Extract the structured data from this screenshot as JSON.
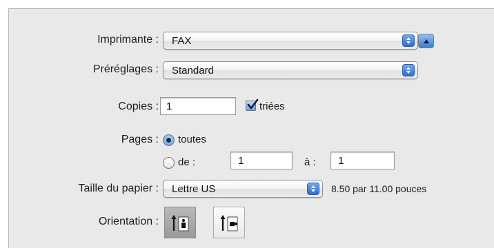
{
  "printer": {
    "label": "Imprimante :",
    "value": "FAX"
  },
  "presets": {
    "label": "Préréglages :",
    "value": "Standard"
  },
  "copies": {
    "label": "Copies :",
    "value": "1",
    "collate_label": "triées",
    "collate_checked": true
  },
  "pages": {
    "label": "Pages :",
    "all_label": "toutes",
    "from_label": "de :",
    "from_value": "1",
    "to_label": "à :",
    "to_value": "1",
    "selected": "all"
  },
  "paper_size": {
    "label": "Taille du papier :",
    "value": "Lettre US",
    "dimensions": "8.50 par 11.00 pouces"
  },
  "orientation": {
    "label": "Orientation :",
    "options": [
      "portrait",
      "landscape"
    ],
    "selected": "portrait"
  },
  "colors": {
    "accent": "#3b7dd6",
    "panel": "#e9e9e9"
  }
}
